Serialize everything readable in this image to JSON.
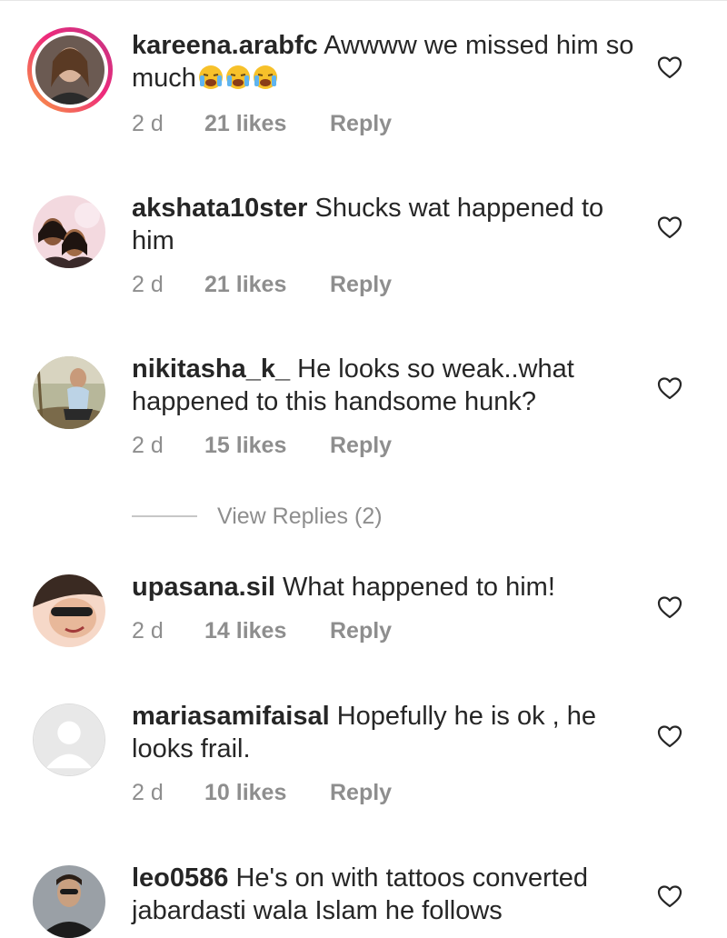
{
  "comments": [
    {
      "username": "kareena.arabfc",
      "text": "Awwww we missed him so much",
      "emoji": [
        "crying-face-emoji",
        "crying-face-emoji",
        "crying-face-emoji"
      ],
      "time": "2 d",
      "likes": "21 likes",
      "reply": "Reply",
      "avatar": "profile-photo",
      "story_ring": true
    },
    {
      "username": "akshata10ster",
      "text": "Shucks wat happened to him",
      "time": "2 d",
      "likes": "21 likes",
      "reply": "Reply",
      "avatar": "profile-photo"
    },
    {
      "username": "nikitasha_k_",
      "text": "He looks so weak..what happened to this handsome hunk?",
      "time": "2 d",
      "likes": "15 likes",
      "reply": "Reply",
      "avatar": "profile-photo"
    },
    {
      "username": "upasana.sil",
      "text": "What happened to him!",
      "time": "2 d",
      "likes": "14 likes",
      "reply": "Reply",
      "avatar": "profile-photo"
    },
    {
      "username": "mariasamifaisal",
      "text": "Hopefully he is ok , he looks frail.",
      "time": "2 d",
      "likes": "10 likes",
      "reply": "Reply",
      "avatar": "default-avatar"
    },
    {
      "username": "leo0586",
      "text": "He's on with tattoos converted jabardasti wala Islam he follows",
      "avatar": "profile-photo"
    }
  ],
  "view_replies": "View Replies (2)",
  "icons": {
    "like": "heart-outline-icon"
  },
  "colors": {
    "text": "#262626",
    "meta": "#8e8e8e",
    "story_ring_start": "#f9a03f",
    "story_ring_end": "#c13584"
  }
}
